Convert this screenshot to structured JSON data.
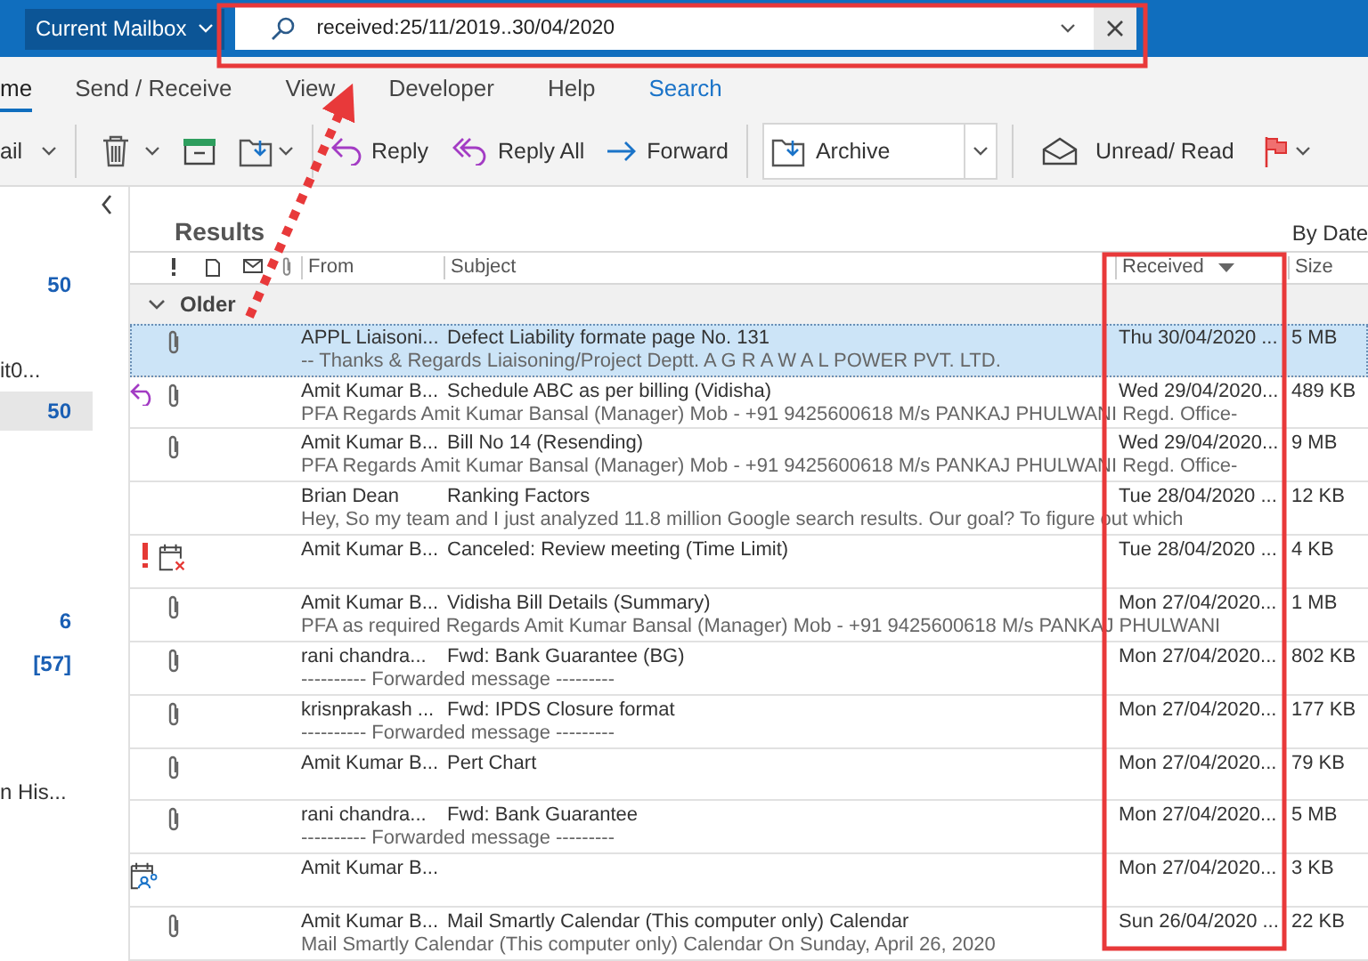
{
  "top_bar": {
    "scope": "Current Mailbox",
    "search": {
      "value": "received:25/11/2019..30/04/2020"
    }
  },
  "tabs": [
    {
      "label": "me",
      "selected": true,
      "kind": "normal"
    },
    {
      "label": "Send / Receive",
      "selected": false,
      "kind": "normal"
    },
    {
      "label": "View",
      "selected": false,
      "kind": "normal"
    },
    {
      "label": "Developer",
      "selected": false,
      "kind": "normal"
    },
    {
      "label": "Help",
      "selected": false,
      "kind": "normal"
    },
    {
      "label": "Search",
      "selected": false,
      "kind": "contextual"
    }
  ],
  "toolbar": {
    "partial_label": "ail",
    "reply": "Reply",
    "reply_all": "Reply All",
    "forward": "Forward",
    "archive": "Archive",
    "unread_read": "Unread/ Read"
  },
  "folder_pane": {
    "items": [
      {
        "text": "50",
        "kind": "count",
        "selected": false
      },
      {
        "text": "it0...",
        "kind": "name",
        "selected": false
      },
      {
        "text": "50",
        "kind": "count",
        "selected": true
      },
      {
        "text": "6",
        "kind": "count",
        "selected": false
      },
      {
        "text": "[57]",
        "kind": "count",
        "selected": false
      },
      {
        "text": "n His...",
        "kind": "name",
        "selected": false
      }
    ]
  },
  "results": {
    "title": "Results",
    "arrangement": "By Date",
    "columns": [
      {
        "label": "From",
        "sorted": false
      },
      {
        "label": "Subject",
        "sorted": false
      },
      {
        "label": "Received",
        "sorted": true
      },
      {
        "label": "Size",
        "sorted": false
      }
    ],
    "group": {
      "label": "Older",
      "expanded": true
    },
    "messages": [
      {
        "from": "APPL Liaisoni...",
        "subject": "Defect Liability formate page No. 131",
        "preview": "--   Thanks & Regards  Liaisoning/Project Deptt.  A G  R A W A L  POWER PVT. LTD.",
        "received": "Thu 30/04/2020 ...",
        "size": "5 MB",
        "attachment": true,
        "high_importance": false,
        "selected": true
      },
      {
        "from": "Amit Kumar B...",
        "subject": "Schedule ABC as per billing (Vidisha)",
        "preview": "PFA  Regards  Amit Kumar Bansal  (Manager)  Mob - +91 9425600618  M/s PANKAJ PHULWANI  Regd. Office-",
        "received": "Wed 29/04/2020...",
        "size": "489 KB",
        "attachment": true,
        "high_importance": false,
        "selected": false,
        "kind": "replied"
      },
      {
        "from": "Amit Kumar B...",
        "subject": "Bill No 14 (Resending)",
        "preview": "PFA  Regards  Amit Kumar Bansal  (Manager)  Mob - +91 9425600618  M/s PANKAJ PHULWANI  Regd. Office-",
        "received": "Wed 29/04/2020...",
        "size": "9 MB",
        "attachment": true,
        "high_importance": false,
        "selected": false
      },
      {
        "from": "Brian Dean",
        "subject": "Ranking Factors",
        "preview": "Hey,  So my team and I just analyzed 11.8 million Google search results.  Our goal?  To figure out which",
        "received": "Tue 28/04/2020 ...",
        "size": "12 KB",
        "attachment": false,
        "high_importance": false,
        "selected": false
      },
      {
        "from": "Amit Kumar B...",
        "subject": "Canceled: Review meeting (Time Limit)",
        "received": "Tue 28/04/2020 ...",
        "size": "4 KB",
        "attachment": false,
        "high_importance": true,
        "selected": false,
        "kind": "meeting_canceled"
      },
      {
        "from": "Amit Kumar B...",
        "subject": "Vidisha Bill Details (Summary)",
        "preview": "PFA as required  Regards  Amit Kumar Bansal  (Manager)  Mob - +91 9425600618  M/s PANKAJ PHULWANI",
        "received": "Mon 27/04/2020...",
        "size": "1 MB",
        "attachment": true,
        "high_importance": false,
        "selected": false
      },
      {
        "from": "rani chandra...",
        "subject": "Fwd: Bank Guarantee (BG)",
        "preview": "---------- Forwarded message ---------",
        "received": "Mon 27/04/2020...",
        "size": "802 KB",
        "attachment": true,
        "high_importance": false,
        "selected": false
      },
      {
        "from": "krisnprakash ...",
        "subject": "Fwd: IPDS Closure format",
        "preview": "---------- Forwarded message ---------",
        "received": "Mon 27/04/2020...",
        "size": "177 KB",
        "attachment": true,
        "high_importance": false,
        "selected": false
      },
      {
        "from": "Amit Kumar B...",
        "subject": "Pert Chart",
        "received": "Mon 27/04/2020...",
        "size": "79 KB",
        "attachment": true,
        "high_importance": false,
        "selected": false
      },
      {
        "from": "rani chandra...",
        "subject": "Fwd: Bank Guarantee",
        "preview": "---------- Forwarded message ---------",
        "received": "Mon 27/04/2020...",
        "size": "5 MB",
        "attachment": true,
        "high_importance": false,
        "selected": false
      },
      {
        "from": "Amit Kumar B...",
        "received": "Mon 27/04/2020...",
        "size": "3 KB",
        "attachment": false,
        "high_importance": false,
        "selected": false,
        "kind": "meeting"
      },
      {
        "from": "Amit Kumar B...",
        "subject": "Mail Smartly Calendar (This computer only) Calendar",
        "preview": "Mail Smartly Calendar (This computer only) Calendar  On Sunday, April 26, 2020",
        "received": "Sun 26/04/2020 ...",
        "size": "22 KB",
        "attachment": true,
        "high_importance": false,
        "selected": false
      }
    ]
  }
}
